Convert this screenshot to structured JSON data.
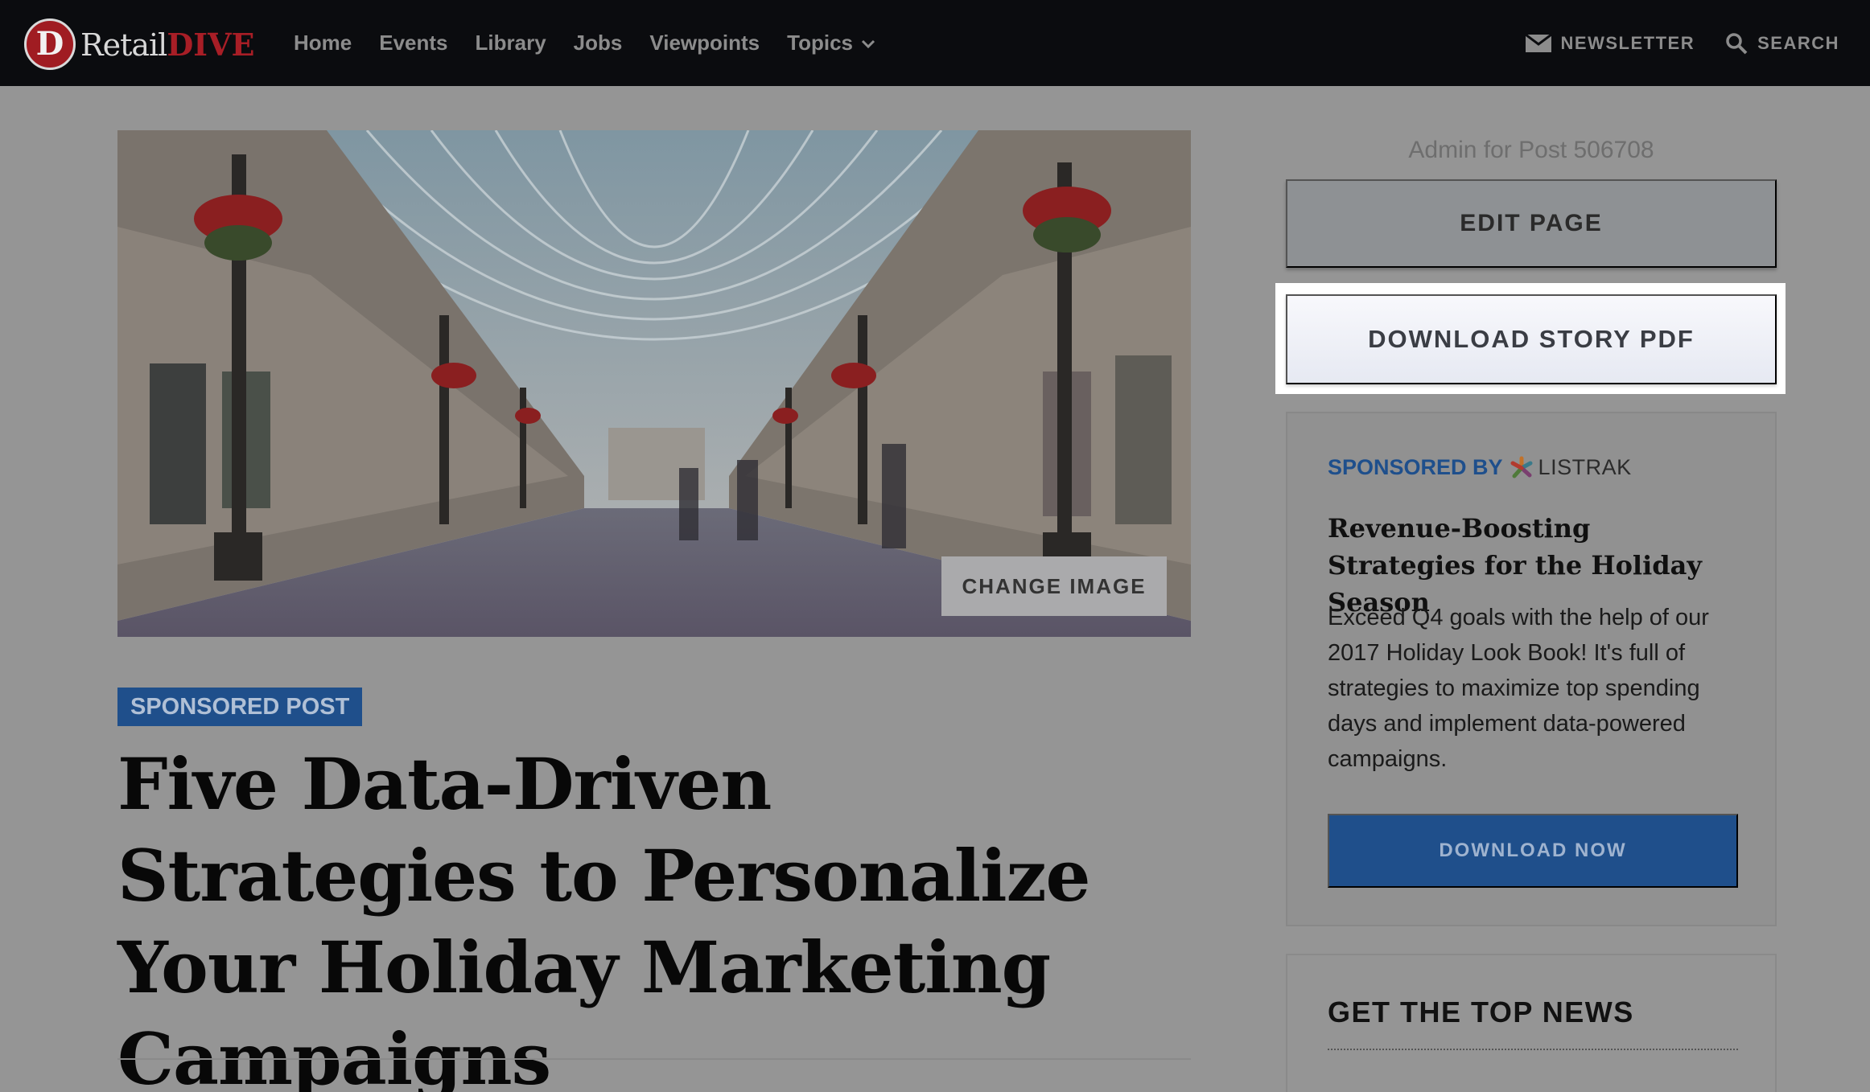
{
  "brand": {
    "badge": "D",
    "name_light": "Retail",
    "name_bold": "DIVE"
  },
  "nav": {
    "items": [
      "Home",
      "Events",
      "Library",
      "Jobs",
      "Viewpoints",
      "Topics"
    ],
    "newsletter": "NEWSLETTER",
    "search": "SEARCH"
  },
  "hero": {
    "change_image": "CHANGE IMAGE"
  },
  "article": {
    "badge": "SPONSORED POST",
    "headline": "Five Data-Driven Strategies to Personalize Your Holiday Marketing Campaigns"
  },
  "sidebar": {
    "admin_label": "Admin for Post 506708",
    "edit_page": "EDIT PAGE",
    "download_pdf": "DOWNLOAD STORY PDF",
    "promo": {
      "sponsored_by": "SPONSORED BY",
      "sponsor": "LISTRAK",
      "title": "Revenue-Boosting Strategies for the Holiday Season",
      "body": "Exceed Q4 goals with the help of our 2017 Holiday Look Book! It's full of strategies to maximize top spending days and implement data-powered campaigns.",
      "cta": "DOWNLOAD NOW"
    },
    "newsletter_box": {
      "title": "GET THE TOP NEWS"
    }
  },
  "colors": {
    "nav_bg": "#0b0c0f",
    "brand_red": "#a81e26",
    "accent_blue": "#1f4f8b",
    "overlay_gray": "#959595"
  },
  "icons": [
    "mail-icon",
    "search-icon",
    "chevron-down-icon",
    "listrak-logo-icon"
  ]
}
